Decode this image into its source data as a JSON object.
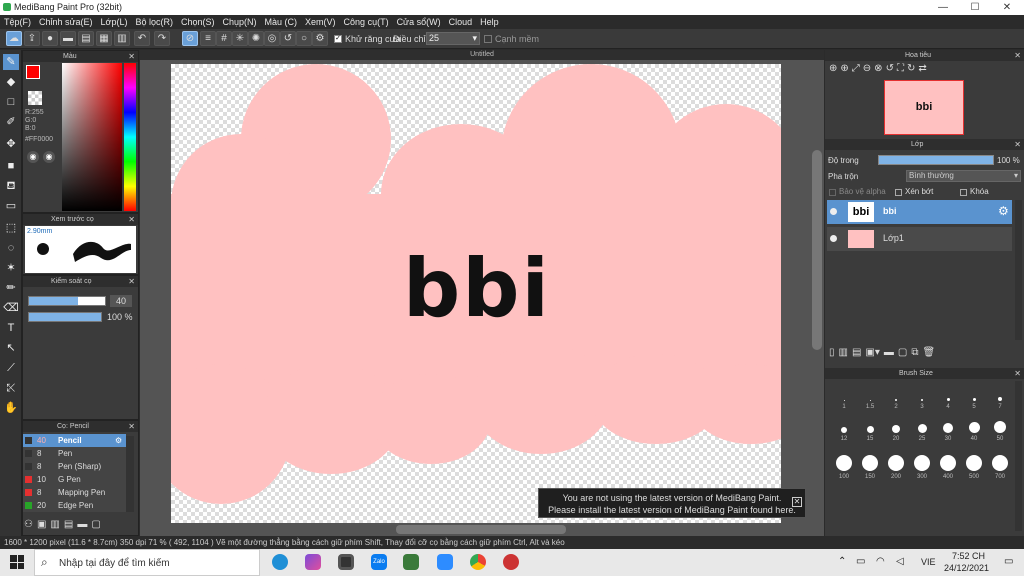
{
  "window": {
    "title": "MediBang Paint Pro (32bit)",
    "minimize": "—",
    "maximize": "☐",
    "close": "✕"
  },
  "menu": [
    "Tệp(F)",
    "Chỉnh sửa(E)",
    "Lớp(L)",
    "Bộ lọc(R)",
    "Chọn(S)",
    "Chụp(N)",
    "Màu (C)",
    "Xem(V)",
    "Công cụ(T)",
    "Cửa sổ(W)",
    "Cloud",
    "Help"
  ],
  "toolbar": {
    "antialias_label": "Khử răng cưa",
    "adjust_label": "Điều chỉnh",
    "adjust_value": "25",
    "snap_label": "Cạnh mềm"
  },
  "color_panel": {
    "title": "Màu",
    "r": "R:255",
    "g": "G:0",
    "b": "B:0",
    "hex": "#FF0000",
    "primary": "#ff0000"
  },
  "brush_preview": {
    "title": "Xem trước cọ",
    "size": "2.90mm"
  },
  "brush_control": {
    "title": "Kiểm soát cọ",
    "size_value": "40",
    "opacity_value": "100 %"
  },
  "brush_list": {
    "title": "Cọ: Pencil",
    "items": [
      {
        "size": "40",
        "name": "Pencil",
        "color": "#333333",
        "selected": true
      },
      {
        "size": "8",
        "name": "Pen",
        "color": "#333333"
      },
      {
        "size": "8",
        "name": "Pen (Sharp)",
        "color": "#333333"
      },
      {
        "size": "10",
        "name": "G Pen",
        "color": "#e53030"
      },
      {
        "size": "8",
        "name": "Mapping Pen",
        "color": "#e53030"
      },
      {
        "size": "20",
        "name": "Edge Pen",
        "color": "#28a428"
      }
    ]
  },
  "canvas": {
    "tab_title": "Untitled",
    "text": "bbi"
  },
  "navigator": {
    "title": "Hoa tiêu",
    "thumb_text": "bbi"
  },
  "layer_panel": {
    "title": "Lớp",
    "opacity_label": "Độ trong",
    "opacity_value": "100 %",
    "blend_label": "Pha trộn",
    "blend_value": "Bình thường",
    "protect_alpha": "Bảo vệ alpha",
    "clipping": "Xén bớt",
    "lock": "Khóa",
    "layers": [
      {
        "name": "bbi",
        "thumb": "bbi",
        "selected": true
      },
      {
        "name": "Lớp1",
        "thumb": "",
        "selected": false
      }
    ]
  },
  "brush_size": {
    "title": "Brush Size",
    "rows": [
      [
        "1",
        "1.5",
        "2",
        "3",
        "4",
        "5",
        "7"
      ],
      [
        "12",
        "15",
        "20",
        "25",
        "30",
        "40",
        "50"
      ],
      [
        "100",
        "150",
        "200",
        "300",
        "400",
        "500",
        "700"
      ]
    ]
  },
  "notice": {
    "line1": "You are not using the latest version of MediBang Paint.",
    "line2": "Please install the latest version of MediBang Paint found here."
  },
  "status": {
    "text": "1600 * 1200 pixel  (11.6 * 8.7cm)  350 dpi  71 %  ( 492, 1104 )  Vẽ một đường thẳng bằng cách giữ phím Shift, Thay đổi cỡ cọ bằng cách giữ phím Ctrl, Alt và kéo"
  },
  "taskbar": {
    "search_placeholder": "Nhập tại đây để tìm kiếm",
    "lang": "VIE",
    "time": "7:52 CH",
    "date": "24/12/2021"
  }
}
